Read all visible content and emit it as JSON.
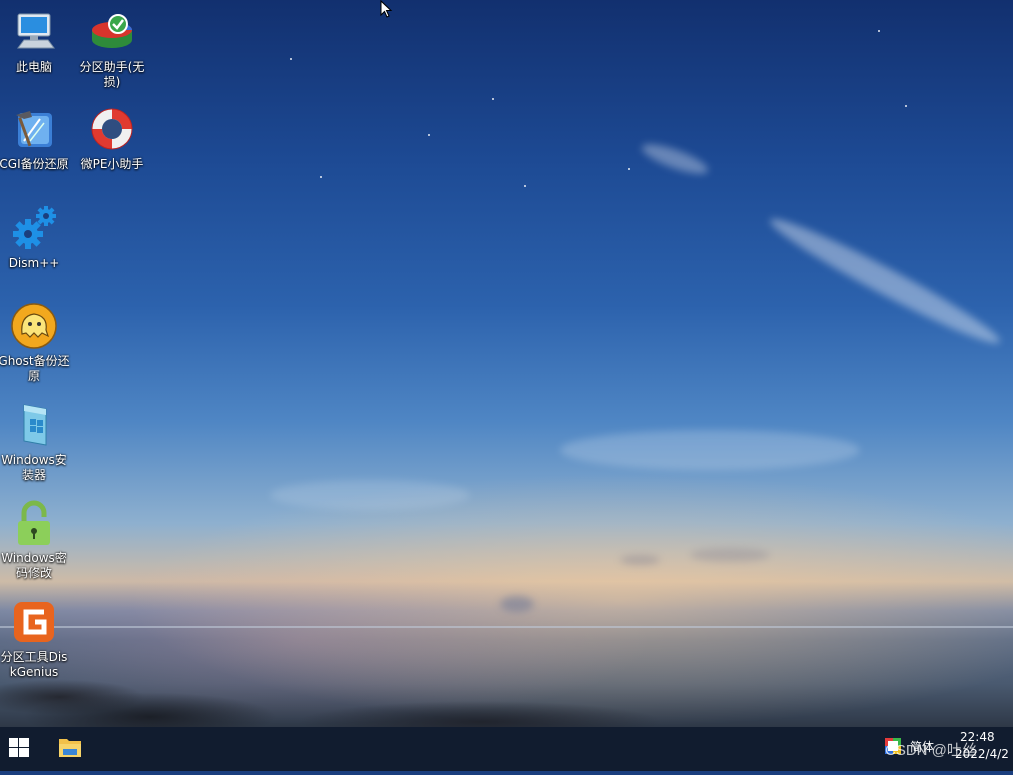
{
  "desktop_icons": [
    {
      "label": "此电脑",
      "icon": "computer-icon"
    },
    {
      "label": "分区助手(无损)",
      "icon": "partition-assistant-icon"
    },
    {
      "label": "CGI备份还原",
      "icon": "cgi-backup-icon"
    },
    {
      "label": "微PE小助手",
      "icon": "lifebuoy-icon"
    },
    {
      "label": "Dism++",
      "icon": "gears-icon"
    },
    {
      "label": "Ghost备份还原",
      "icon": "ghost-icon"
    },
    {
      "label": "Windows安装器",
      "icon": "windows-installer-icon"
    },
    {
      "label": "Windows密码修改",
      "icon": "padlock-icon"
    },
    {
      "label": "分区工具DiskGenius",
      "icon": "diskgenius-icon"
    }
  ],
  "taskbar": {
    "start_icon": "windows-logo-icon",
    "pinned": [
      {
        "icon": "file-explorer-icon"
      }
    ],
    "tray": {
      "ime_label": "简体",
      "time": "22:48",
      "date": "2022/4/2"
    }
  },
  "watermark": "CSDN @吐丝"
}
